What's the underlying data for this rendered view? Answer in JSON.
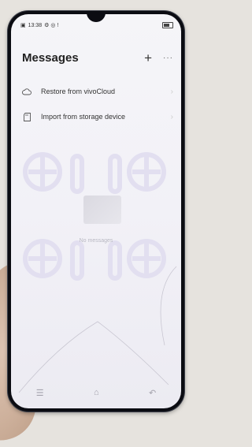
{
  "status_bar": {
    "time": "13:38",
    "indicators": "⚙ ◎ !"
  },
  "header": {
    "title": "Messages",
    "add_label": "+",
    "more_label": "···"
  },
  "menu": {
    "items": [
      {
        "label": "Restore from vivoCloud",
        "icon": "cloud-icon"
      },
      {
        "label": "Import from storage device",
        "icon": "storage-icon"
      }
    ]
  },
  "empty_state": {
    "text": "No messages"
  },
  "colors": {
    "accent": "#222222",
    "background": "#f4f3f7"
  }
}
